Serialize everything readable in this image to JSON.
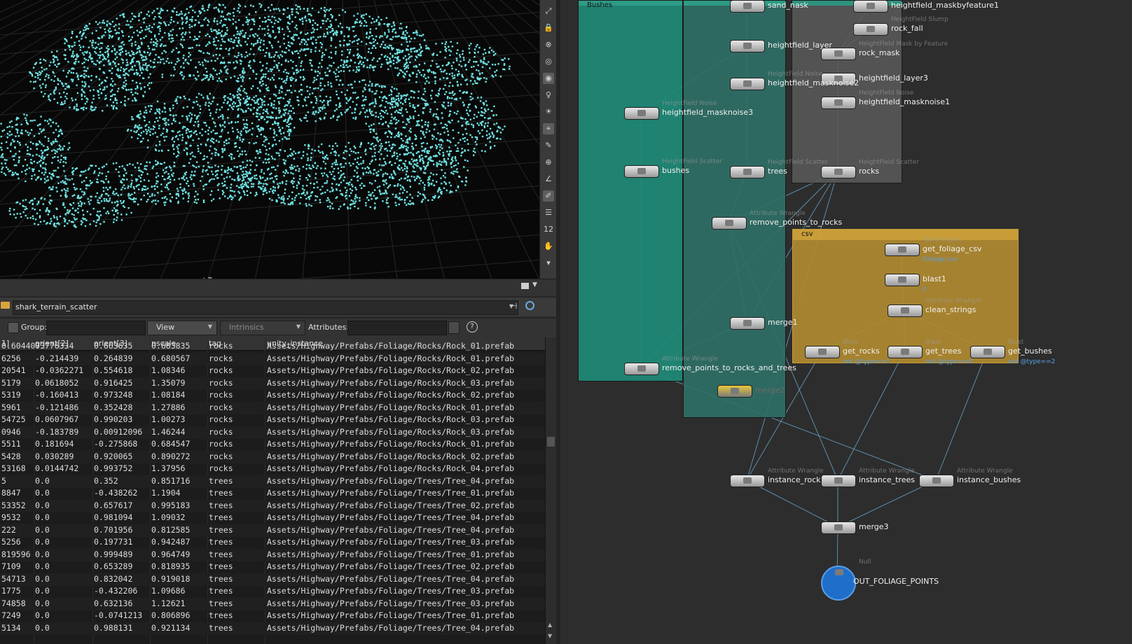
{
  "viewport": {
    "tool_icons": [
      "select-icon",
      "lock-icon",
      "snap-icon",
      "display-icon",
      "light-icon",
      "camera-icon",
      "paint-icon",
      "brush-icon",
      "handle-icon",
      "magnet-icon",
      "measure-icon",
      "pin-icon",
      "ruler-icon",
      "number-icon",
      "eraser-icon",
      "down-icon"
    ],
    "tool_number": "12"
  },
  "spreadsheet": {
    "node_path": "shark_terrain_scatter",
    "group_label": "Group:",
    "group_value": "",
    "view_label": "View",
    "intrinsics_label": "Intrinsics",
    "attributes_label": "Attributes:",
    "attributes_value": "",
    "help_icon": "?",
    "columns": [
      "1]",
      "orient[2]",
      "orient[3]",
      "pscale",
      "tag",
      "unity_instance"
    ],
    "rows": [
      [
        "0.6044073",
        "0.776334",
        "0.663635",
        "0.683835",
        "rocks",
        "Assets/Highway/Prefabs/Foliage/Rocks/Rock_01.prefab"
      ],
      [
        "6256",
        "-0.214439",
        "0.264839",
        "0.680567",
        "rocks",
        "Assets/Highway/Prefabs/Foliage/Rocks/Rock_01.prefab"
      ],
      [
        "20541",
        "-0.0362271",
        "0.554618",
        "1.08346",
        "rocks",
        "Assets/Highway/Prefabs/Foliage/Rocks/Rock_02.prefab"
      ],
      [
        "5179",
        "0.0618052",
        "0.916425",
        "1.35079",
        "rocks",
        "Assets/Highway/Prefabs/Foliage/Rocks/Rock_03.prefab"
      ],
      [
        "5319",
        "-0.160413",
        "0.973248",
        "1.08184",
        "rocks",
        "Assets/Highway/Prefabs/Foliage/Rocks/Rock_02.prefab"
      ],
      [
        "5961",
        "-0.121486",
        "0.352428",
        "1.27886",
        "rocks",
        "Assets/Highway/Prefabs/Foliage/Rocks/Rock_01.prefab"
      ],
      [
        "54725",
        "0.0607967",
        "0.990203",
        "1.00273",
        "rocks",
        "Assets/Highway/Prefabs/Foliage/Rocks/Rock_03.prefab"
      ],
      [
        "0946",
        "-0.183789",
        "0.00912096",
        "1.46244",
        "rocks",
        "Assets/Highway/Prefabs/Foliage/Rocks/Rock_03.prefab"
      ],
      [
        "5511",
        "0.181694",
        "-0.275868",
        "0.684547",
        "rocks",
        "Assets/Highway/Prefabs/Foliage/Rocks/Rock_01.prefab"
      ],
      [
        "5428",
        "0.030289",
        "0.920065",
        "0.890272",
        "rocks",
        "Assets/Highway/Prefabs/Foliage/Rocks/Rock_02.prefab"
      ],
      [
        "53168",
        "0.0144742",
        "0.993752",
        "1.37956",
        "rocks",
        "Assets/Highway/Prefabs/Foliage/Rocks/Rock_04.prefab"
      ],
      [
        "5",
        "0.0",
        "0.352",
        "0.851716",
        "trees",
        "Assets/Highway/Prefabs/Foliage/Trees/Tree_04.prefab"
      ],
      [
        "8847",
        "0.0",
        "-0.438262",
        "1.1904",
        "trees",
        "Assets/Highway/Prefabs/Foliage/Trees/Tree_01.prefab"
      ],
      [
        "53352",
        "0.0",
        "0.657617",
        "0.995183",
        "trees",
        "Assets/Highway/Prefabs/Foliage/Trees/Tree_02.prefab"
      ],
      [
        "9532",
        "0.0",
        "0.981094",
        "1.09032",
        "trees",
        "Assets/Highway/Prefabs/Foliage/Trees/Tree_04.prefab"
      ],
      [
        "222",
        "0.0",
        "0.701956",
        "0.812585",
        "trees",
        "Assets/Highway/Prefabs/Foliage/Trees/Tree_04.prefab"
      ],
      [
        "5256",
        "0.0",
        "0.197731",
        "0.942487",
        "trees",
        "Assets/Highway/Prefabs/Foliage/Trees/Tree_03.prefab"
      ],
      [
        "819596",
        "0.0",
        "0.999489",
        "0.964749",
        "trees",
        "Assets/Highway/Prefabs/Foliage/Trees/Tree_01.prefab"
      ],
      [
        "7109",
        "0.0",
        "0.653289",
        "0.818935",
        "trees",
        "Assets/Highway/Prefabs/Foliage/Trees/Tree_02.prefab"
      ],
      [
        "54713",
        "0.0",
        "0.832042",
        "0.919018",
        "trees",
        "Assets/Highway/Prefabs/Foliage/Trees/Tree_04.prefab"
      ],
      [
        "1775",
        "0.0",
        "-0.432206",
        "1.09686",
        "trees",
        "Assets/Highway/Prefabs/Foliage/Trees/Tree_03.prefab"
      ],
      [
        "74858",
        "0.0",
        "0.632136",
        "1.12621",
        "trees",
        "Assets/Highway/Prefabs/Foliage/Trees/Tree_03.prefab"
      ],
      [
        "7249",
        "0.0",
        "-0.0741213",
        "0.806896",
        "trees",
        "Assets/Highway/Prefabs/Foliage/Trees/Tree_01.prefab"
      ],
      [
        "5134",
        "0.0",
        "0.988131",
        "0.921134",
        "trees",
        "Assets/Highway/Prefabs/Foliage/Trees/Tree_04.prefab"
      ]
    ]
  },
  "network": {
    "boxes": [
      {
        "id": "bushes",
        "title": "Bushes",
        "color": "#1f8a77"
      },
      {
        "id": "trees",
        "title": "",
        "color": "#2f6f66"
      },
      {
        "id": "rocks",
        "title": "",
        "color": "#5a5a5a"
      },
      {
        "id": "csv",
        "title": "csv",
        "color": "#b08a30"
      }
    ],
    "nodes": [
      {
        "id": "sand_mask",
        "label": "sand_nask",
        "type": "",
        "extra": ""
      },
      {
        "id": "maskbyfeature1",
        "label": "heightfield_maskbyfeature1",
        "type": "",
        "extra": ""
      },
      {
        "id": "rock_fall",
        "label": "rock_fall",
        "type": "HeightField Slump",
        "extra": ""
      },
      {
        "id": "hf_layer",
        "label": "heightfield_layer",
        "type": "",
        "extra": ""
      },
      {
        "id": "rock_mask",
        "label": "rock_mask",
        "type": "HeightField Mask by Feature",
        "extra": ""
      },
      {
        "id": "hf_layer3",
        "label": "heightfield_layer3",
        "type": "",
        "extra": ""
      },
      {
        "id": "hf_masknoise2",
        "label": "heightfield_masknoise2",
        "type": "HeightField Noise",
        "extra": ""
      },
      {
        "id": "hf_masknoise1",
        "label": "heightfield_masknoise1",
        "type": "HeightField Noise",
        "extra": ""
      },
      {
        "id": "hf_masknoise3",
        "label": "heightfield_masknoise3",
        "type": "HeightField Noise",
        "extra": ""
      },
      {
        "id": "bushes",
        "label": "bushes",
        "type": "HeightField Scatter",
        "extra": ""
      },
      {
        "id": "trees",
        "label": "trees",
        "type": "HeightField Scatter",
        "extra": ""
      },
      {
        "id": "rocks",
        "label": "rocks",
        "type": "HeightField Scatter",
        "extra": ""
      },
      {
        "id": "remove_points_to_rocks",
        "label": "remove_points_to_rocks",
        "type": "Attribute Wrangle",
        "extra": ""
      },
      {
        "id": "get_foliage_csv",
        "label": "get_foliage_csv",
        "type": "Table Import",
        "extra": "Foliage.csv"
      },
      {
        "id": "blast1",
        "label": "blast1",
        "type": "",
        "extra": "0"
      },
      {
        "id": "clean_strings",
        "label": "clean_strings",
        "type": "Attribute Wrangle",
        "extra": ""
      },
      {
        "id": "merge1",
        "label": "merge1",
        "type": "",
        "extra": ""
      },
      {
        "id": "get_rocks",
        "label": "get_rocks",
        "type": "Blast",
        "extra": "not @type==1"
      },
      {
        "id": "get_trees",
        "label": "get_trees",
        "type": "Blast",
        "extra": "not @type==0"
      },
      {
        "id": "get_bushes",
        "label": "get_bushes",
        "type": "Blast",
        "extra": "not @type==2"
      },
      {
        "id": "remove_points_to_rocks_and_trees",
        "label": "remove_points_to_rocks_and_trees",
        "type": "Attribute Wrangle",
        "extra": ""
      },
      {
        "id": "merge2",
        "label": "merge2",
        "type": "",
        "extra": ""
      },
      {
        "id": "instance_rocks",
        "label": "instance_rocks",
        "type": "Attribute Wrangle",
        "extra": ""
      },
      {
        "id": "instance_trees",
        "label": "instance_trees",
        "type": "Attribute Wrangle",
        "extra": ""
      },
      {
        "id": "instance_bushes",
        "label": "instance_bushes",
        "type": "Attribute Wrangle",
        "extra": ""
      },
      {
        "id": "merge3",
        "label": "merge3",
        "type": "",
        "extra": ""
      },
      {
        "id": "out",
        "label": "OUT_FOLIAGE_POINTS",
        "type": "Null",
        "extra": ""
      }
    ]
  },
  "colors": {
    "points": "#6fe3e3",
    "wire": "#6aaed6",
    "bushes_box": "#1f8a77",
    "csv_box": "#b08a30"
  }
}
